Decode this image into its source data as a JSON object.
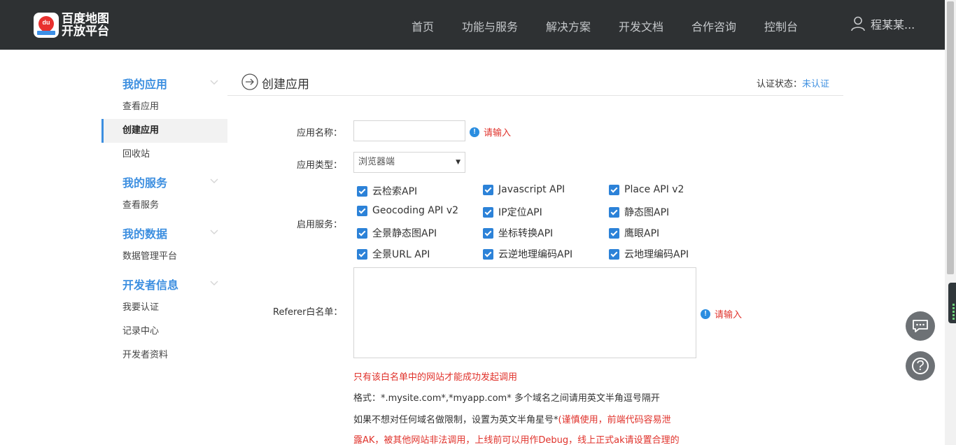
{
  "header": {
    "logo_line1": "百度地图",
    "logo_line2": "开放平台",
    "logo_mark": "du",
    "nav": [
      "首页",
      "功能与服务",
      "解决方案",
      "开发文档",
      "合作咨询",
      "控制台"
    ],
    "user_name": "程某某...",
    "user_icon": "user-icon"
  },
  "sidebar": {
    "groups": [
      {
        "title": "我的应用",
        "items": [
          "查看应用",
          "创建应用",
          "回收站"
        ]
      },
      {
        "title": "我的服务",
        "items": [
          "查看服务"
        ]
      },
      {
        "title": "我的数据",
        "items": [
          "数据管理平台"
        ]
      },
      {
        "title": "开发者信息",
        "items": [
          "我要认证",
          "记录中心",
          "开发者资料"
        ]
      }
    ],
    "active_item": "创建应用"
  },
  "page": {
    "title": "创建应用",
    "cert_label": "认证状态：",
    "cert_value": "未认证"
  },
  "form": {
    "app_name_label": "应用名称：",
    "app_name_value": "",
    "app_name_hint": "请输入",
    "app_type_label": "应用类型：",
    "app_type_value": "浏览器端",
    "services_label": "启用服务：",
    "services": [
      "云检索API",
      "Javascript API",
      "Place API v2",
      "Geocoding API v2",
      "IP定位API",
      "静态图API",
      "全景静态图API",
      "坐标转换API",
      "鹰眼API",
      "全景URL API",
      "云逆地理编码API",
      "云地理编码API"
    ],
    "referer_label": "Referer白名单：",
    "referer_value": "",
    "referer_hint": "请输入",
    "note_only": "只有该白名单中的网站才能成功发起调用",
    "note_format": "格式：*.mysite.com*,*myapp.com* 多个域名之间请用英文半角逗号隔开",
    "note_star_prefix": "如果不想对任何域名做限制，设置为英文半角星号*",
    "note_star_warn1": "(谨慎使用，前端代码容易泄",
    "note_star_warn2": "露AK，被其他网站非法调用，上线前可以用作Debug，线上正式ak请设置合理的"
  },
  "floating": {
    "chat_icon": "chat-icon",
    "help_icon": "help-icon",
    "help_glyph": "?"
  },
  "colors": {
    "topbar": "#2e3133",
    "accent": "#3d8fe0",
    "warn": "#e0322b",
    "checkbox": "#2c82d8"
  }
}
